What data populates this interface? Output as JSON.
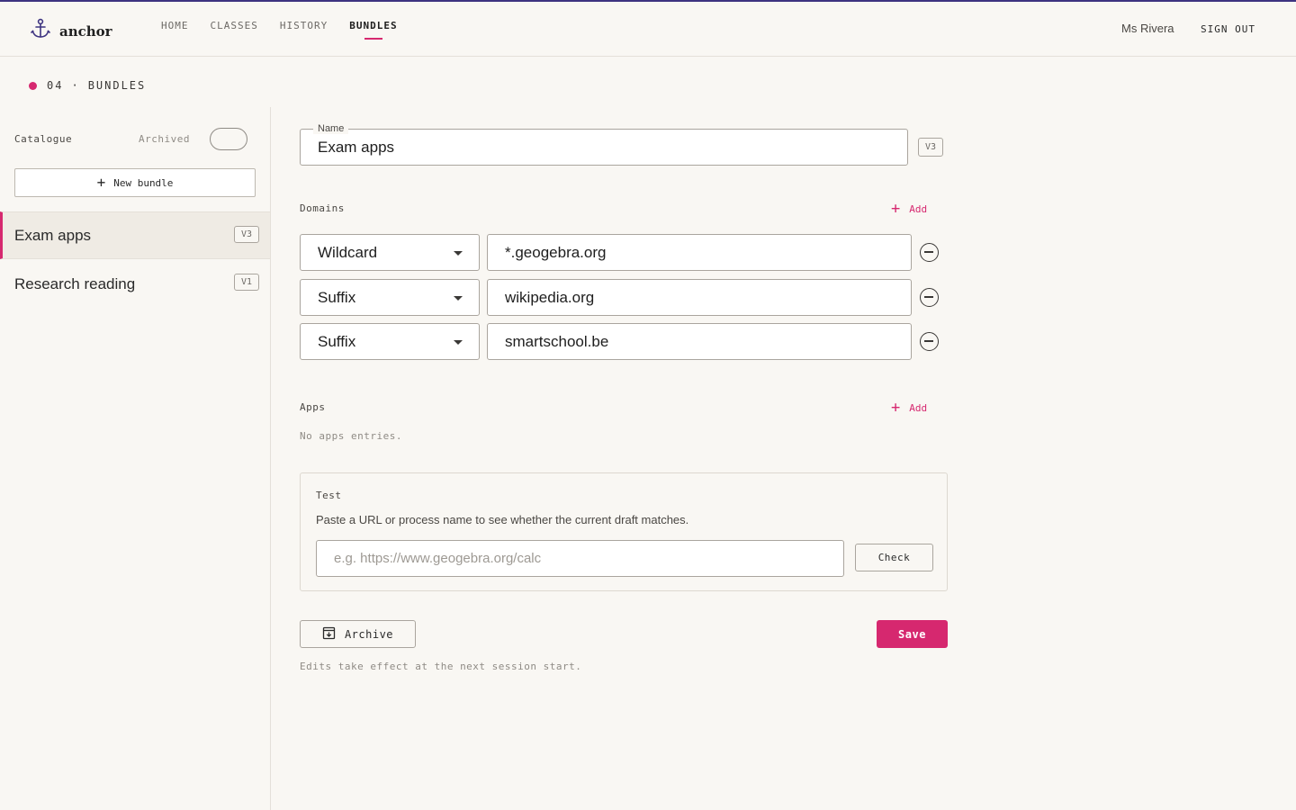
{
  "app": {
    "name": "anchor",
    "logo_icon": "anchor-icon"
  },
  "nav": {
    "items": [
      {
        "label": "HOME"
      },
      {
        "label": "CLASSES"
      },
      {
        "label": "HISTORY"
      },
      {
        "label": "BUNDLES",
        "active": true
      }
    ]
  },
  "user": {
    "name": "Ms Rivera",
    "sign_out": "SIGN OUT"
  },
  "section": {
    "number": "04",
    "separator": "·",
    "title": "BUNDLES"
  },
  "sidebar": {
    "catalogue_label": "Catalogue",
    "archived_label": "Archived",
    "archived_toggle": false,
    "new_bundle_label": "New bundle",
    "bundles": [
      {
        "name": "Exam apps",
        "version": "V3",
        "active": true
      },
      {
        "name": "Research reading",
        "version": "V1"
      }
    ]
  },
  "form": {
    "name_label": "Name",
    "name_value": "Exam apps",
    "version": "V3",
    "domains_label": "Domains",
    "add_label": "Add",
    "domains": [
      {
        "type": "Wildcard",
        "value": "*.geogebra.org"
      },
      {
        "type": "Suffix",
        "value": "wikipedia.org"
      },
      {
        "type": "Suffix",
        "value": "smartschool.be"
      }
    ],
    "apps_label": "Apps",
    "apps_empty": "No apps entries.",
    "test": {
      "title": "Test",
      "description": "Paste a URL or process name to see whether the current draft matches.",
      "placeholder": "e.g. https://www.geogebra.org/calc",
      "check_label": "Check"
    },
    "archive_label": "Archive",
    "save_label": "Save",
    "footnote": "Edits take effect at the next session start."
  },
  "colors": {
    "accent": "#d6286f",
    "top_line": "#3d3380",
    "background": "#f9f7f3"
  }
}
